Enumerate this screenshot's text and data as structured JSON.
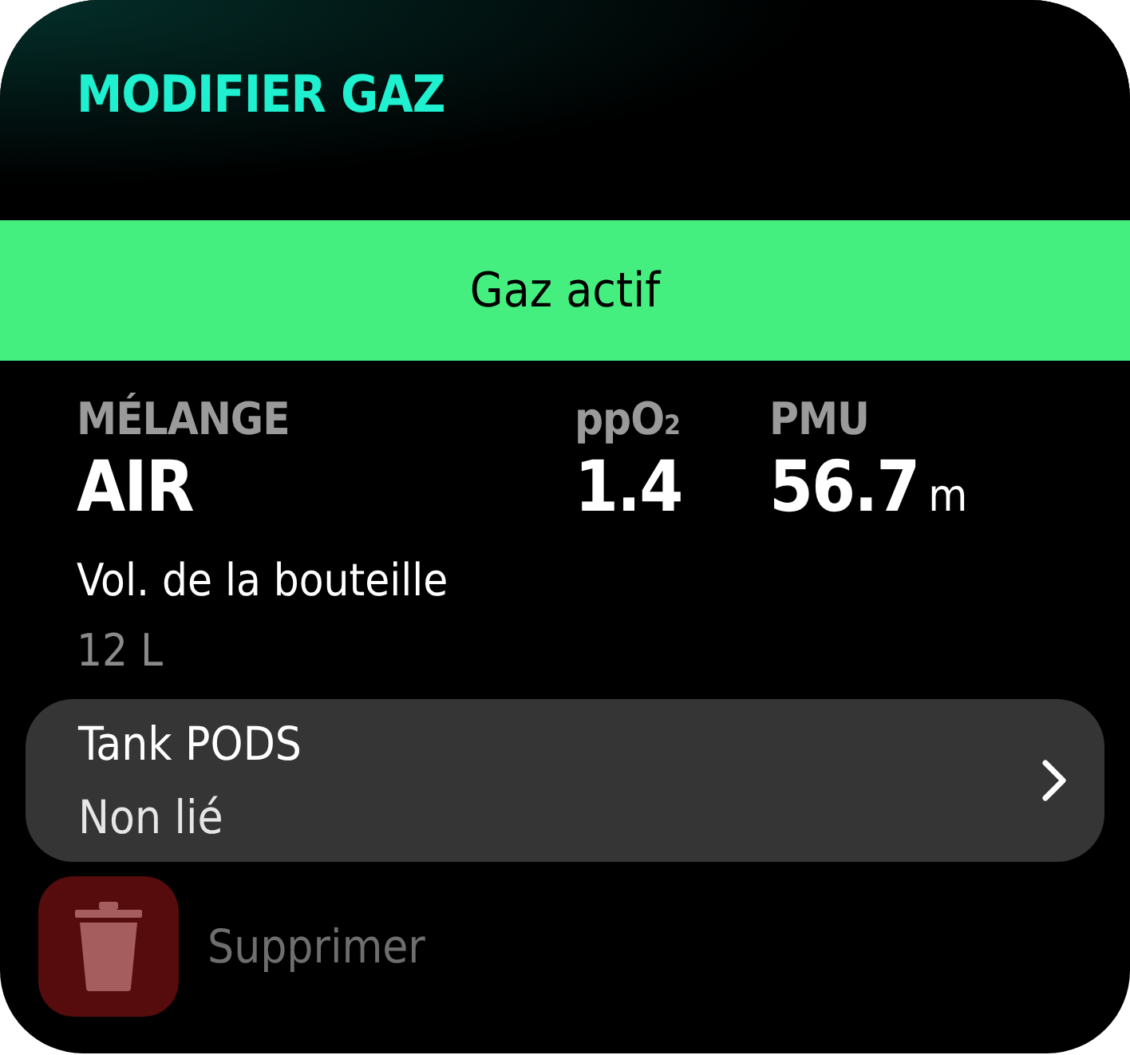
{
  "title": "MODIFIER GAZ",
  "status_banner": {
    "label": "Gaz actif",
    "active": true
  },
  "stats": [
    {
      "label": "MÉLANGE",
      "value": "AIR"
    },
    {
      "label": "ppO$_{2}$",
      "value": "1.4"
    },
    {
      "label": "PMU",
      "value": "56.7",
      "unit": "m"
    }
  ],
  "volume": {
    "label": "Vol. de la bouteille",
    "value": "12 L"
  },
  "tank_pods": {
    "title": "Tank PODS",
    "status": "Non lié"
  },
  "delete": {
    "label": "Supprimer",
    "disabled": true
  }
}
